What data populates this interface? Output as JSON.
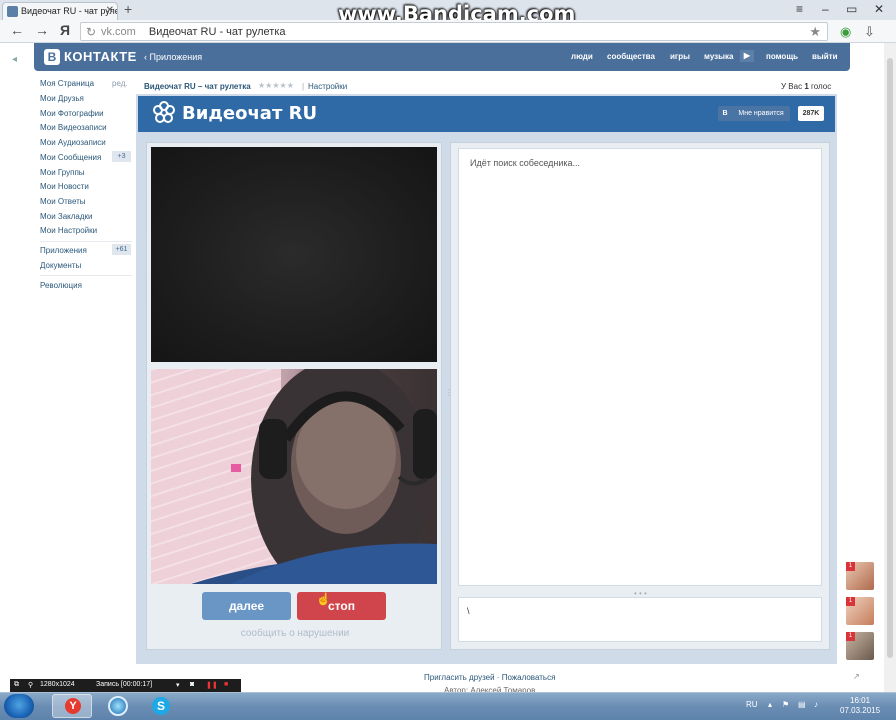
{
  "browser": {
    "tab_title": "Видеочат RU - чат рулетка",
    "new_tab": "+",
    "address_domain": "vk.com",
    "address_title": "Видеочат RU - чат рулетка",
    "watermark": "www.Bandicam.com",
    "back_icon": "←",
    "forward_icon": "→",
    "yandex_icon": "Я"
  },
  "vk_header": {
    "logo_letter": "В",
    "logo_text": "КОНТАКТЕ",
    "apps_back": "‹ Приложения",
    "nav": [
      "люди",
      "сообщества",
      "игры",
      "музыка",
      "помощь",
      "выйти"
    ]
  },
  "left_menu": {
    "items": [
      {
        "label": "Моя Страница",
        "extra": "ред."
      },
      {
        "label": "Мои Друзья"
      },
      {
        "label": "Мои Фотографии"
      },
      {
        "label": "Мои Видеозаписи"
      },
      {
        "label": "Мои Аудиозаписи"
      },
      {
        "label": "Мои Сообщения",
        "badge": "+3"
      },
      {
        "label": "Мои Группы"
      },
      {
        "label": "Мои Новости"
      },
      {
        "label": "Мои Ответы"
      },
      {
        "label": "Мои Закладки"
      },
      {
        "label": "Мои Настройки"
      }
    ],
    "apps": {
      "label": "Приложения",
      "badge": "+61"
    },
    "documents": "Документы",
    "revolution": "Революция"
  },
  "app": {
    "title": "Видеочат RU – чат рулетка",
    "stars": "★★★★★",
    "settings": "Настройки",
    "votes_prefix": "У Вас ",
    "votes_count": "1",
    "votes_suffix": " голос",
    "banner_title": "Видеочат RU",
    "like_b": "В",
    "like_label": "Мне нравится",
    "like_count": "287K"
  },
  "chat": {
    "status": "Идёт поиск собеседника...",
    "input_value": "\\",
    "next_button": "далее",
    "stop_button": "стоп",
    "report_link": "сообщить о нарушении"
  },
  "footer": {
    "invite": "Пригласить друзей",
    "sep": " · ",
    "complain": "Пожаловаться",
    "author": "Автор: Алексей Томаров"
  },
  "bandicam_bar": {
    "resolution": "1280x1024",
    "recording": "Запись [00:00:17]"
  },
  "notifications": {
    "badges": [
      "1",
      "1",
      "1"
    ],
    "more": "↗"
  },
  "tray": {
    "lang": "RU",
    "time": "16:01",
    "date": "07.03.2015"
  },
  "colors": {
    "vk_blue": "#4a6f9b",
    "banner_blue": "#2f6aa7",
    "next_button": "#6a96c6",
    "stop_button": "#d0454b",
    "link": "#2b587a"
  }
}
